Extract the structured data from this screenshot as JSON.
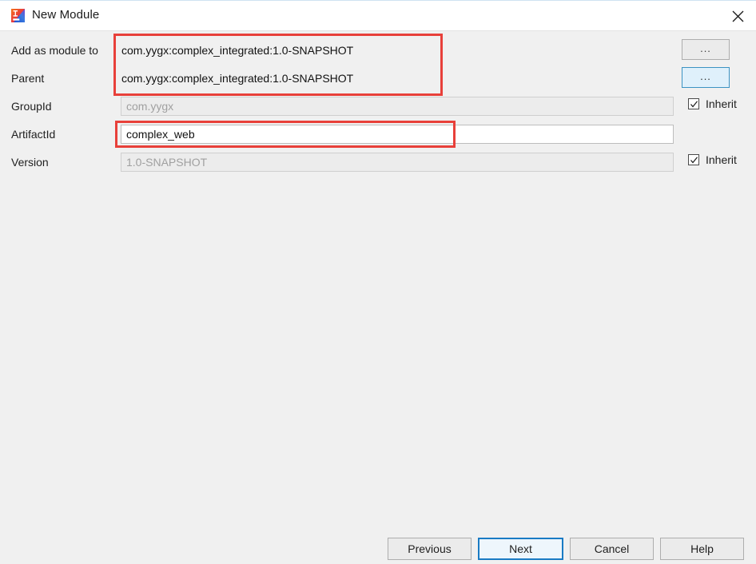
{
  "window": {
    "title": "New Module",
    "icon": "intellij-idea-icon",
    "close_icon": "close-icon"
  },
  "form": {
    "rows": [
      {
        "label": "Add as module to",
        "value": "com.yygx:complex_integrated:1.0-SNAPSHOT",
        "kind": "plain"
      },
      {
        "label": "Parent",
        "value": "com.yygx:complex_integrated:1.0-SNAPSHOT",
        "kind": "plain"
      },
      {
        "label": "GroupId",
        "value": "com.yygx",
        "kind": "field-disabled"
      },
      {
        "label": "ArtifactId",
        "value": "complex_web",
        "kind": "field-editable"
      },
      {
        "label": "Version",
        "value": "1.0-SNAPSHOT",
        "kind": "field-disabled"
      }
    ],
    "browse_buttons": [
      {
        "label": "...",
        "name": "browse-module-button",
        "focused": false
      },
      {
        "label": "...",
        "name": "browse-parent-button",
        "focused": true
      }
    ],
    "inherit_checkboxes": [
      {
        "label": "Inherit",
        "checked": true,
        "name": "inherit-groupid-checkbox"
      },
      {
        "label": "Inherit",
        "checked": true,
        "name": "inherit-version-checkbox"
      }
    ]
  },
  "annotations": {
    "color": "#e8403a",
    "boxes": [
      {
        "name": "annotation-parent-fields",
        "targets": "Add as module to / Parent"
      },
      {
        "name": "annotation-artifactid-field",
        "targets": "ArtifactId"
      }
    ]
  },
  "footer": {
    "buttons": [
      {
        "label": "Previous",
        "name": "previous-button",
        "default": false
      },
      {
        "label": "Next",
        "name": "next-button",
        "default": true
      },
      {
        "label": "Cancel",
        "name": "cancel-button",
        "default": false
      },
      {
        "label": "Help",
        "name": "help-button",
        "default": false
      }
    ]
  }
}
